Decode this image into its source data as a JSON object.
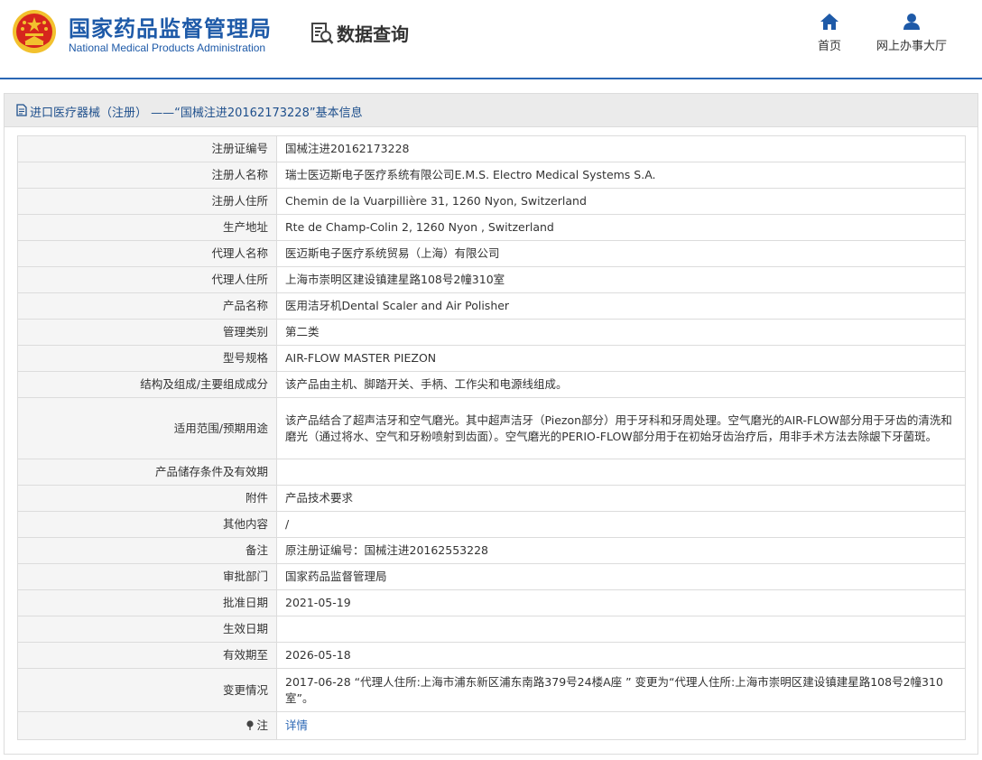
{
  "header": {
    "brand_cn": "国家药品监督管理局",
    "brand_en": "National Medical Products Administration",
    "data_query": "数据查询",
    "nav": {
      "home": "首页",
      "online_office": "网上办事大厅"
    },
    "colors": {
      "brand": "#1e5aa8",
      "emblem_red": "#d6261d",
      "emblem_gold": "#f2c12e"
    }
  },
  "panel": {
    "title": "进口医疗器械（注册） ——“国械注进20162173228”基本信息",
    "icon": "document-icon"
  },
  "rows": [
    {
      "label": "注册证编号",
      "value": "国械注进20162173228"
    },
    {
      "label": "注册人名称",
      "value": "瑞士医迈斯电子医疗系统有限公司E.M.S. Electro Medical Systems S.A."
    },
    {
      "label": "注册人住所",
      "value": "Chemin de la Vuarpillière 31, 1260 Nyon, Switzerland"
    },
    {
      "label": "生产地址",
      "value": "Rte de Champ-Colin 2, 1260 Nyon , Switzerland"
    },
    {
      "label": "代理人名称",
      "value": "医迈斯电子医疗系统贸易（上海）有限公司"
    },
    {
      "label": "代理人住所",
      "value": "上海市崇明区建设镇建星路108号2幢310室"
    },
    {
      "label": "产品名称",
      "value": "医用洁牙机Dental Scaler and Air Polisher"
    },
    {
      "label": "管理类别",
      "value": "第二类"
    },
    {
      "label": "型号规格",
      "value": "AIR-FLOW MASTER PIEZON"
    },
    {
      "label": "结构及组成/主要组成成分",
      "value": "该产品由主机、脚踏开关、手柄、工作尖和电源线组成。"
    },
    {
      "label": "适用范围/预期用途",
      "value": "该产品结合了超声洁牙和空气磨光。其中超声洁牙（Piezon部分）用于牙科和牙周处理。空气磨光的AIR-FLOW部分用于牙齿的清洗和磨光（通过将水、空气和牙粉喷射到齿面）。空气磨光的PERIO-FLOW部分用于在初始牙齿治疗后，用非手术方法去除龈下牙菌斑。"
    },
    {
      "label": "产品储存条件及有效期",
      "value": ""
    },
    {
      "label": "附件",
      "value": "产品技术要求"
    },
    {
      "label": "其他内容",
      "value": "/"
    },
    {
      "label": "备注",
      "value": "原注册证编号：国械注进20162553228"
    },
    {
      "label": "审批部门",
      "value": "国家药品监督管理局"
    },
    {
      "label": "批准日期",
      "value": "2021-05-19"
    },
    {
      "label": "生效日期",
      "value": ""
    },
    {
      "label": "有效期至",
      "value": "2026-05-18"
    },
    {
      "label": "变更情况",
      "value": "2017-06-28 “代理人住所:上海市浦东新区浦东南路379号24楼A座 ” 变更为“代理人住所:上海市崇明区建设镇建星路108号2幢310室”。"
    }
  ],
  "note": {
    "label": "注",
    "link": "详情",
    "icon": "pin-icon"
  }
}
